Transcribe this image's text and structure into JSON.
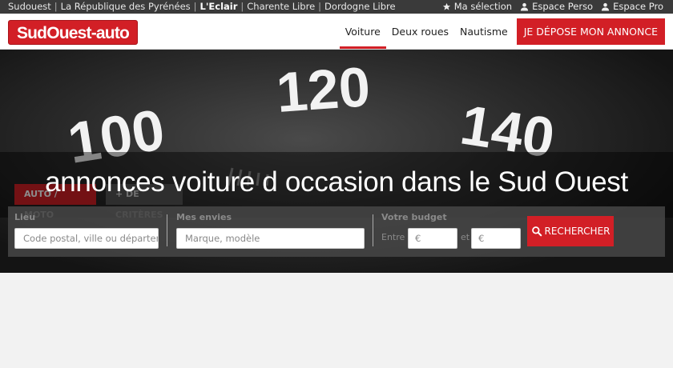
{
  "topbar": {
    "sites": [
      "Sudouest",
      "La République des Pyrénées",
      "L'Eclair",
      "Charente Libre",
      "Dordogne Libre"
    ],
    "separator": "|",
    "tools": {
      "selection": "Ma sélection",
      "perso": "Espace Perso",
      "pro": "Espace Pro"
    }
  },
  "header": {
    "logo": "SudOuest-auto",
    "nav": [
      "Voiture",
      "Deux roues",
      "Nautisme"
    ],
    "cta": "JE DÉPOSE MON ANNONCE"
  },
  "hero": {
    "dials": [
      "100",
      "120",
      "140"
    ],
    "title": "annonces voiture d occasion dans le Sud Ouest"
  },
  "search": {
    "tabs": [
      "AUTO / MOTO",
      "+ DE CRITÈRES"
    ],
    "lieu_label": "Lieu",
    "lieu_placeholder": "Code postal, ville ou département",
    "envies_label": "Mes envies",
    "envies_placeholder": "Marque, modèle",
    "budget_label": "Votre budget",
    "budget_between": "Entre",
    "budget_and": "et",
    "min_placeholder": "€",
    "max_placeholder": "€",
    "submit": "RECHERCHER"
  },
  "colors": {
    "brand_red": "#d21f26",
    "topbar": "#3a3a3a"
  }
}
